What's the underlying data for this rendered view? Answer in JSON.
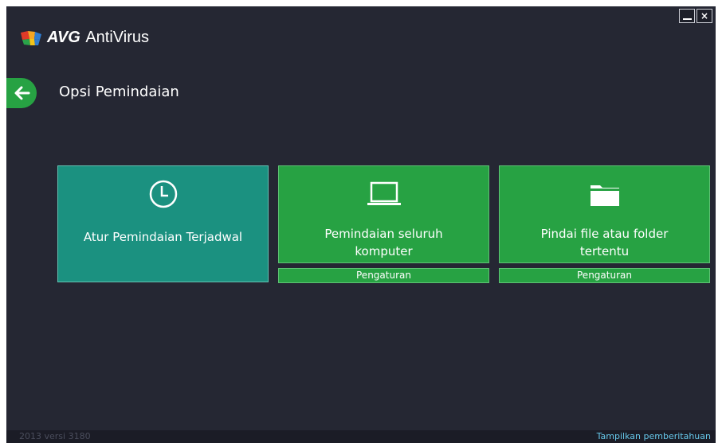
{
  "window": {
    "controls": {
      "minimize_label": "",
      "close_label": "×"
    }
  },
  "brand": {
    "name_bold": "AVG",
    "name_rest": "AntiVirus"
  },
  "page": {
    "title": "Opsi Pemindaian"
  },
  "tiles": [
    {
      "label": "Atur Pemindaian Terjadwal",
      "icon": "clock-icon"
    },
    {
      "label_line1": "Pemindaian seluruh",
      "label_line2": "komputer",
      "icon": "laptop-icon",
      "settings": "Pengaturan"
    },
    {
      "label_line1": "Pindai file atau folder",
      "label_line2": "tertentu",
      "icon": "folder-icon",
      "settings": "Pengaturan"
    }
  ],
  "status": {
    "version": "2013  versi 3180",
    "notify_link": "Tampilkan pemberitahuan"
  },
  "colors": {
    "background": "#252733",
    "accent_green": "#27a243",
    "teal": "#1b9180",
    "link": "#66c7e9"
  }
}
